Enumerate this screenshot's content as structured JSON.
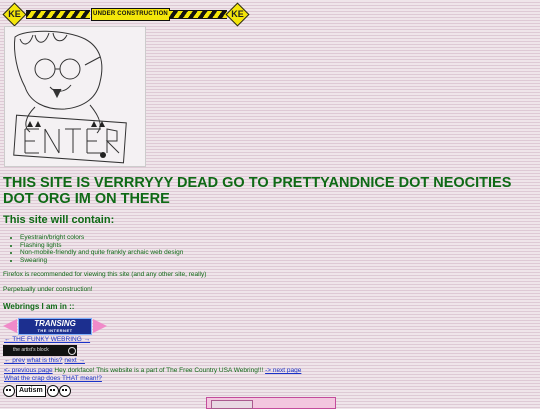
{
  "banner": {
    "label": "UNDER CONSTRUCTION",
    "left_symbol": "KE",
    "right_symbol": "KE"
  },
  "main_title": "THIS SITE IS VERRRYYY DEAD GO TO PRETTYANDNICE DOT NEOCITIES DOT ORG IM ON THERE",
  "sub_title": "This site will contain:",
  "features": [
    "Eyestrain/bright colors",
    "Flashing lights",
    "Non-mobile-friendly and quite frankly archaic web design",
    "Swearing"
  ],
  "firefox_note": "Firefox is recommended for viewing this site (and any other site, really)",
  "construction_note": "Perpetually under construction!",
  "webrings_heading": "Webrings I am in ::",
  "transing": {
    "title": "TRANSING",
    "subtitle": "THE INTERNET"
  },
  "funky_webring": "← THE FUNKY WEBRING →",
  "artists_block": {
    "label": "the artist's block"
  },
  "artists_nav": {
    "prev": "← prev",
    "what": "what is this?",
    "next": "next →"
  },
  "usa_webring": {
    "prev": "<- previous page",
    "text": "Hey dorkface! This website is a part of The Free Country USA Webring!!!",
    "next": "-> next page"
  },
  "crap_link": "What the crap does THAT mean!?",
  "autism_label": "Autism"
}
